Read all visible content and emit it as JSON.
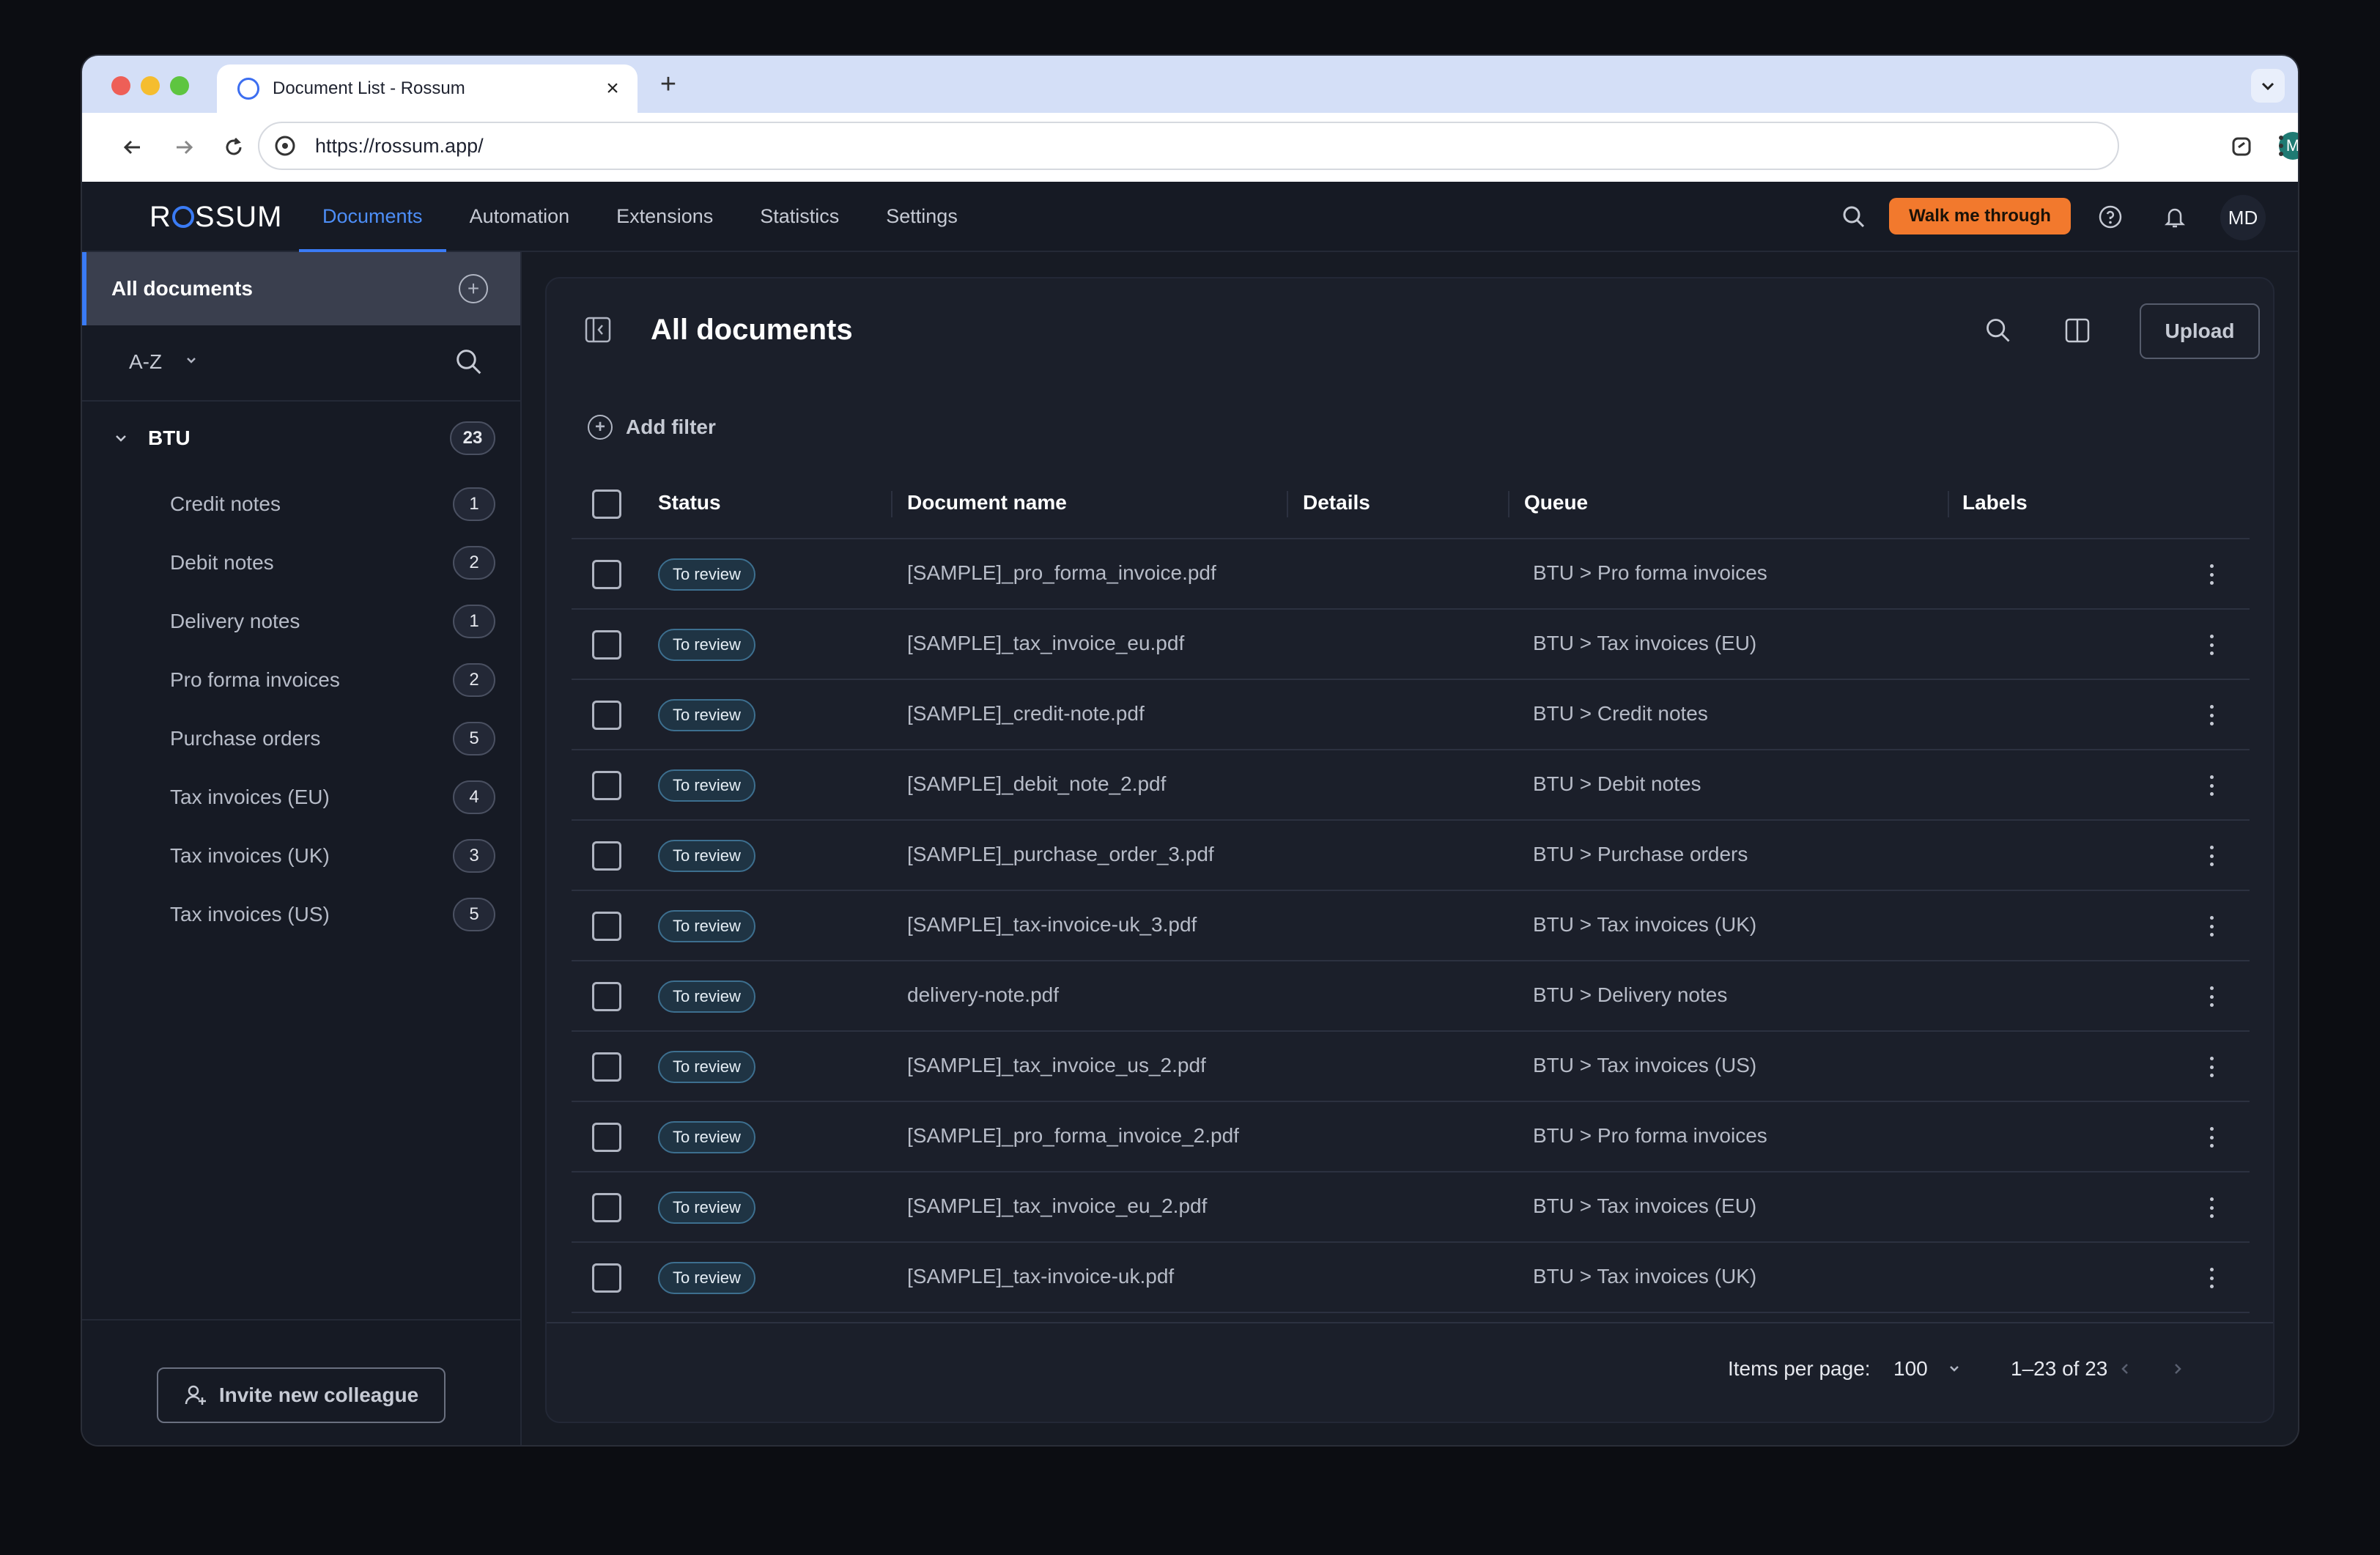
{
  "browser": {
    "tab_title": "Document List - Rossum",
    "url": "https://rossum.app/",
    "profile_initial": "M"
  },
  "app": {
    "logo_text": "ROSSUM",
    "nav": [
      {
        "label": "Documents",
        "active": true
      },
      {
        "label": "Automation",
        "active": false
      },
      {
        "label": "Extensions",
        "active": false
      },
      {
        "label": "Statistics",
        "active": false
      },
      {
        "label": "Settings",
        "active": false
      }
    ],
    "walk_me_through": "Walk me through",
    "user_initials": "MD",
    "accent_color": "#3a7bf5",
    "cta_color": "#f2792d"
  },
  "sidebar": {
    "all_documents": "All documents",
    "sort_label": "A-Z",
    "group": {
      "name": "BTU",
      "count": "23"
    },
    "queues": [
      {
        "name": "Credit notes",
        "count": "1"
      },
      {
        "name": "Debit notes",
        "count": "2"
      },
      {
        "name": "Delivery notes",
        "count": "1"
      },
      {
        "name": "Pro forma invoices",
        "count": "2"
      },
      {
        "name": "Purchase orders",
        "count": "5"
      },
      {
        "name": "Tax invoices (EU)",
        "count": "4"
      },
      {
        "name": "Tax invoices (UK)",
        "count": "3"
      },
      {
        "name": "Tax invoices (US)",
        "count": "5"
      }
    ],
    "invite_label": "Invite new colleague"
  },
  "main": {
    "title": "All documents",
    "upload_label": "Upload",
    "add_filter_label": "Add filter",
    "columns": {
      "status": "Status",
      "document_name": "Document name",
      "details": "Details",
      "queue": "Queue",
      "labels": "Labels"
    },
    "rows": [
      {
        "status": "To review",
        "name": "[SAMPLE]_pro_forma_invoice.pdf",
        "queue": "BTU > Pro forma invoices"
      },
      {
        "status": "To review",
        "name": "[SAMPLE]_tax_invoice_eu.pdf",
        "queue": "BTU > Tax invoices (EU)"
      },
      {
        "status": "To review",
        "name": "[SAMPLE]_credit-note.pdf",
        "queue": "BTU > Credit notes"
      },
      {
        "status": "To review",
        "name": "[SAMPLE]_debit_note_2.pdf",
        "queue": "BTU > Debit notes"
      },
      {
        "status": "To review",
        "name": "[SAMPLE]_purchase_order_3.pdf",
        "queue": "BTU > Purchase orders"
      },
      {
        "status": "To review",
        "name": "[SAMPLE]_tax-invoice-uk_3.pdf",
        "queue": "BTU > Tax invoices (UK)"
      },
      {
        "status": "To review",
        "name": "delivery-note.pdf",
        "queue": "BTU > Delivery notes"
      },
      {
        "status": "To review",
        "name": "[SAMPLE]_tax_invoice_us_2.pdf",
        "queue": "BTU > Tax invoices (US)"
      },
      {
        "status": "To review",
        "name": "[SAMPLE]_pro_forma_invoice_2.pdf",
        "queue": "BTU > Pro forma invoices"
      },
      {
        "status": "To review",
        "name": "[SAMPLE]_tax_invoice_eu_2.pdf",
        "queue": "BTU > Tax invoices (EU)"
      },
      {
        "status": "To review",
        "name": "[SAMPLE]_tax-invoice-uk.pdf",
        "queue": "BTU > Tax invoices (UK)"
      }
    ],
    "pagination": {
      "items_per_page_label": "Items per page:",
      "items_per_page": "100",
      "range": "1–23 of 23"
    }
  }
}
